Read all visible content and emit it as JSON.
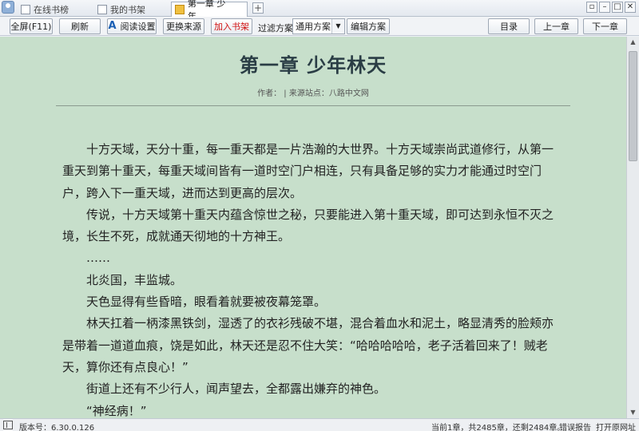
{
  "tabs": {
    "online": "在线书榜",
    "shelf": "我的书架",
    "current": "第一章 少年..."
  },
  "toolbar": {
    "fullscreen": "全屏(F11)",
    "refresh": "刷新",
    "settings": "阅读设置",
    "change_source": "更换来源",
    "add_shelf": "加入书架",
    "filter_label": "过滤方案:",
    "filter_value": "通用方案",
    "edit_filter": "编辑方案",
    "toc": "目录",
    "prev": "上一章",
    "next": "下一章"
  },
  "chapter": {
    "title": "第一章 少年林天",
    "meta": "作者：  | 来源站点：八路中文网",
    "paragraphs": [
      "十方天域，天分十重，每一重天都是一片浩瀚的大世界。十方天域崇尚武道修行，从第一重天到第十重天，每重天域间皆有一道时空门户相连，只有具备足够的实力才能通过时空门户，跨入下一重天域，进而达到更高的层次。",
      "传说，十方天域第十重天内蕴含惊世之秘，只要能进入第十重天域，即可达到永恒不灭之境，长生不死，成就通天彻地的十方神王。",
      "……",
      "北炎国，丰监城。",
      "天色显得有些昏暗，眼看着就要被夜幕笼罩。",
      "林天扛着一柄漆黑铁剑，湿透了的衣衫残破不堪，混合着血水和泥土，略显清秀的脸颊亦是带着一道道血痕，饶是如此，林天还是忍不住大笑：“哈哈哈哈哈，老子活着回来了！贼老天，算你还有点良心！”",
      "街道上还有不少行人，闻声望去，全都露出嫌弃的神色。",
      "“神经病！”"
    ]
  },
  "status": {
    "version": "版本号：6.30.0.126",
    "progress": "当前1章，共2485章，还剩2484章。",
    "report": "错误报告",
    "open_web": "打开原网址"
  }
}
